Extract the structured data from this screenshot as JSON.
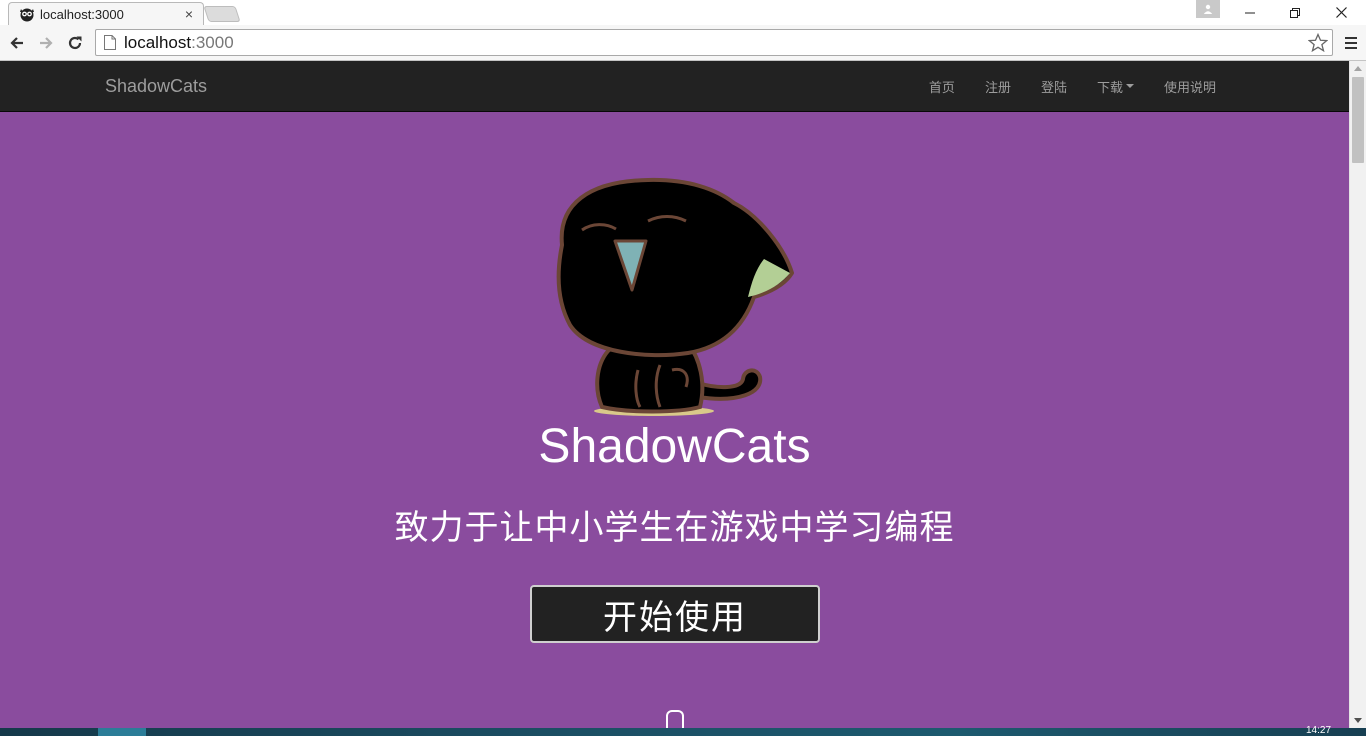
{
  "browser": {
    "tab_title": "localhost:3000",
    "tab_close_glyph": "×",
    "url_host": "localhost",
    "url_port": ":3000",
    "window_minimize_glyph": "—",
    "window_restore_glyph": "❐",
    "window_close_glyph": "✕"
  },
  "navbar": {
    "brand": "ShadowCats",
    "links": [
      {
        "label": "首页"
      },
      {
        "label": "注册"
      },
      {
        "label": "登陆"
      },
      {
        "label": "下载"
      },
      {
        "label": "使用说明"
      }
    ]
  },
  "hero": {
    "title": "ShadowCats",
    "subtitle": "致力于让中小学生在游戏中学习编程",
    "cta_label": "开始使用"
  },
  "taskbar": {
    "clock_partial": "14:27"
  },
  "colors": {
    "hero_background": "#8a4c9e",
    "navbar_background": "#222222",
    "button_background": "#222222"
  }
}
